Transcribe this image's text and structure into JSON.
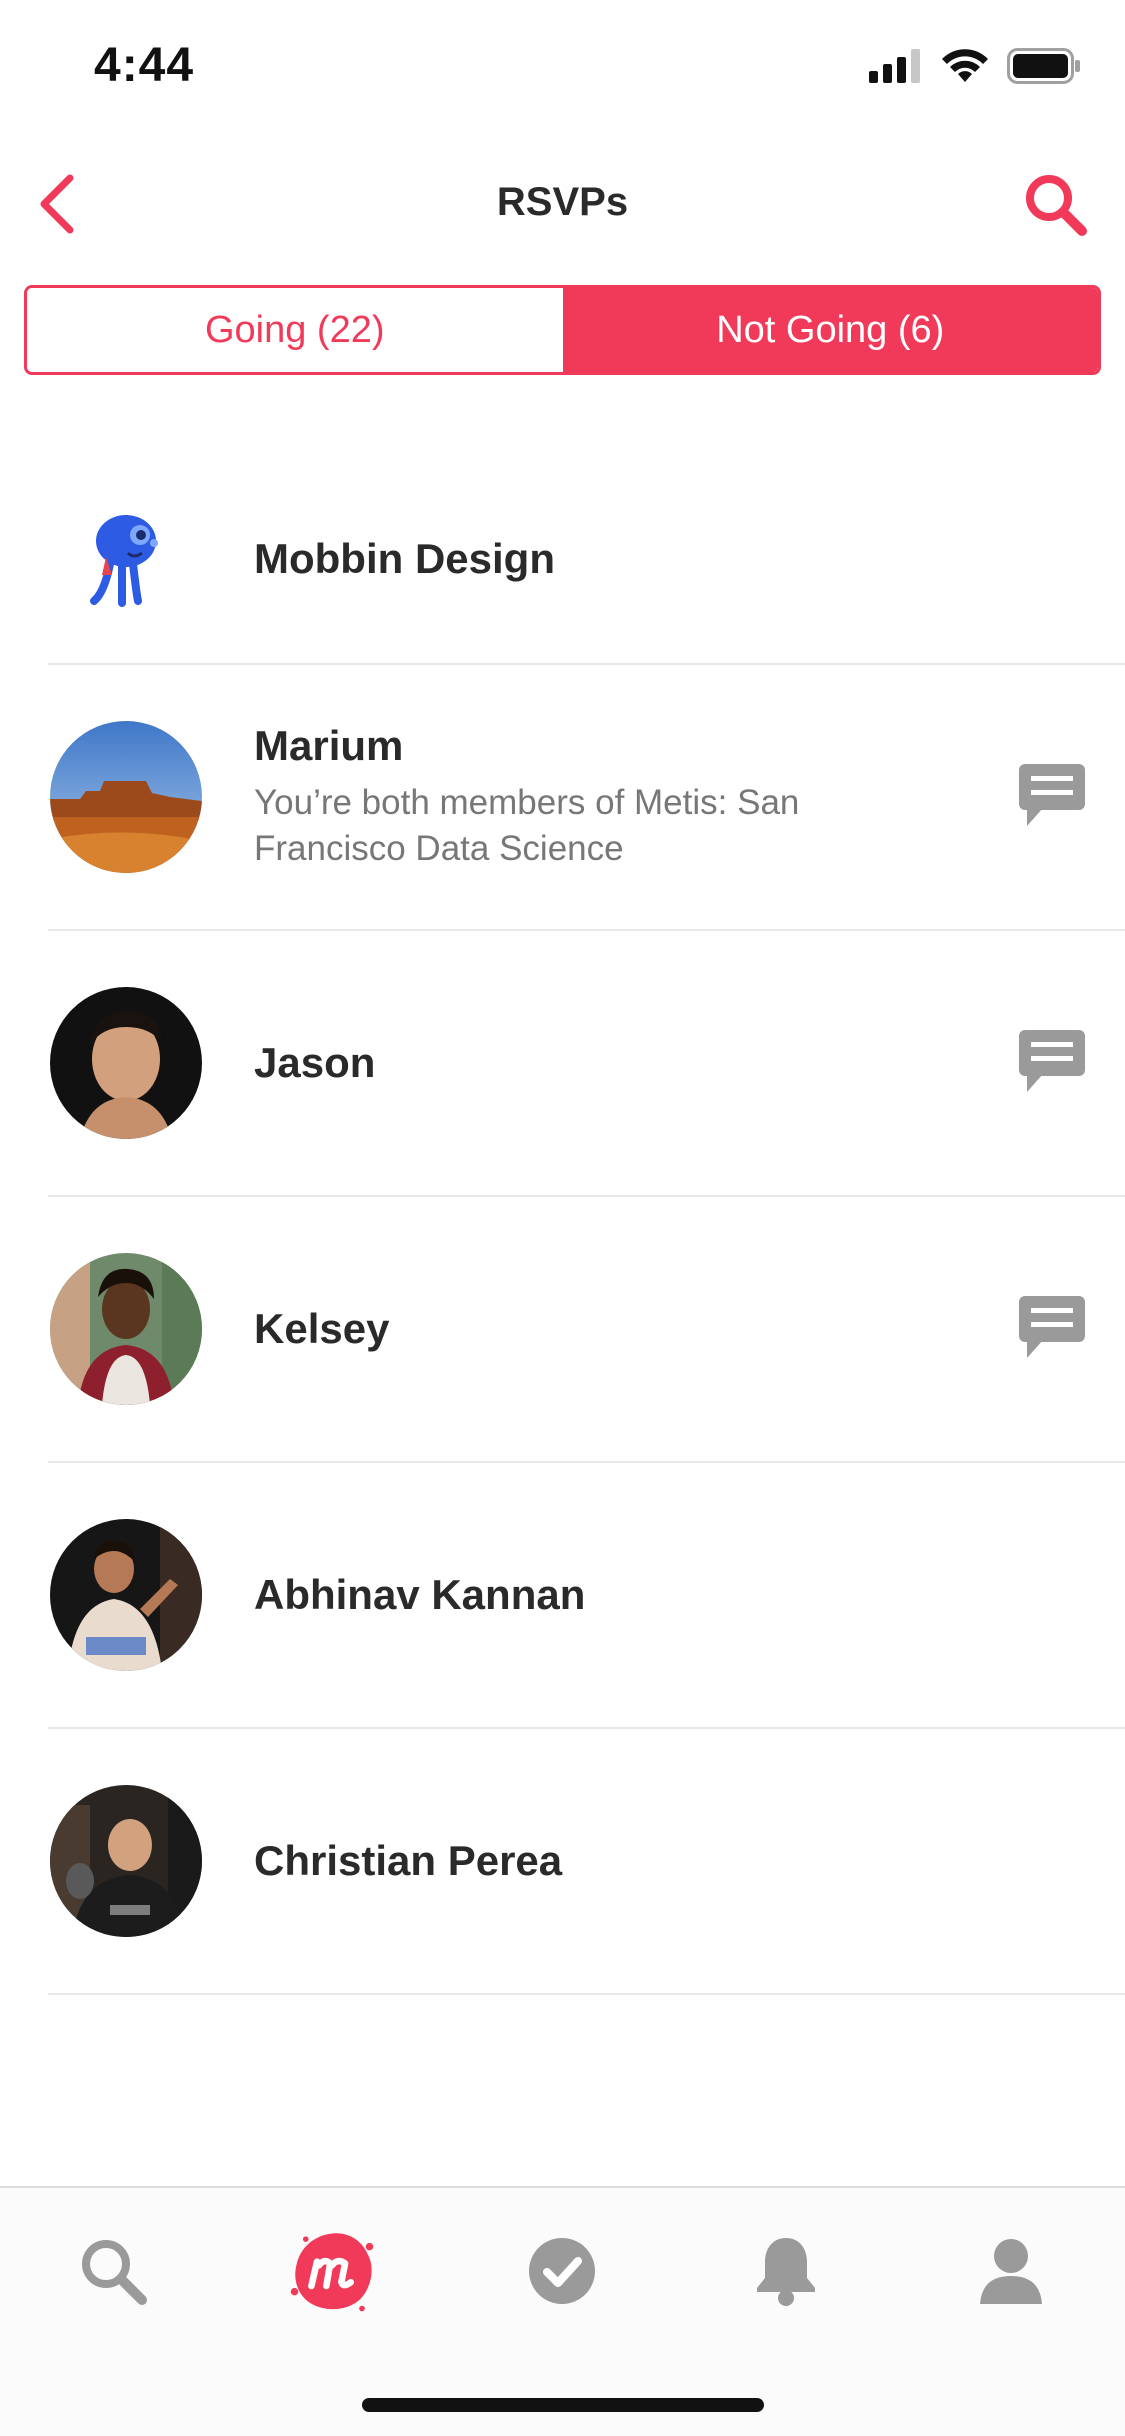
{
  "status_bar": {
    "time": "4:44"
  },
  "nav": {
    "title": "RSVPs"
  },
  "tabs": {
    "going_label": "Going (22)",
    "not_going_label": "Not Going (6)"
  },
  "members": [
    {
      "name": "Mobbin Design",
      "subtitle": "",
      "has_message": false,
      "avatar": "mascot-avatar"
    },
    {
      "name": "Marium",
      "subtitle": "You’re both members of Metis: San Francisco Data Science",
      "has_message": true,
      "avatar": "desert-avatar"
    },
    {
      "name": "Jason",
      "subtitle": "",
      "has_message": true,
      "avatar": "portrait-avatar"
    },
    {
      "name": "Kelsey",
      "subtitle": "",
      "has_message": true,
      "avatar": "portrait-avatar"
    },
    {
      "name": "Abhinav Kannan",
      "subtitle": "",
      "has_message": false,
      "avatar": "portrait-avatar"
    },
    {
      "name": "Christian Perea",
      "subtitle": "",
      "has_message": false,
      "avatar": "portrait-avatar"
    }
  ],
  "bottom_nav": [
    "search-icon",
    "meetup-logo-icon",
    "checkmark-icon",
    "bell-icon",
    "profile-icon"
  ],
  "colors": {
    "accent": "#f13a59",
    "icon_gray": "#9a9a9a"
  }
}
